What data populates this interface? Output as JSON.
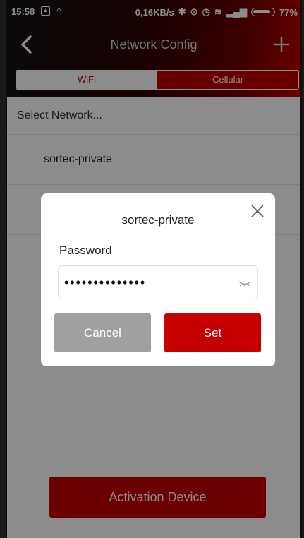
{
  "status_bar": {
    "time": "15:58",
    "speed": "0,16KB/s",
    "battery": "77%"
  },
  "navbar": {
    "title": "Network Config",
    "back_icon": "chevron-left-icon",
    "add_icon": "plus-icon"
  },
  "tabs": [
    {
      "label": "WiFi",
      "selected": true
    },
    {
      "label": "Cellular",
      "selected": false
    }
  ],
  "list": {
    "header": "Select Network...",
    "items": [
      "sortec-private"
    ]
  },
  "activation_button": "Activation Device",
  "dialog": {
    "title": "sortec-private",
    "password_label": "Password",
    "password_value": "••••••••••••••",
    "cancel_label": "Cancel",
    "set_label": "Set"
  },
  "colors": {
    "accent": "#c60000",
    "cancel": "#a0a0a0"
  }
}
